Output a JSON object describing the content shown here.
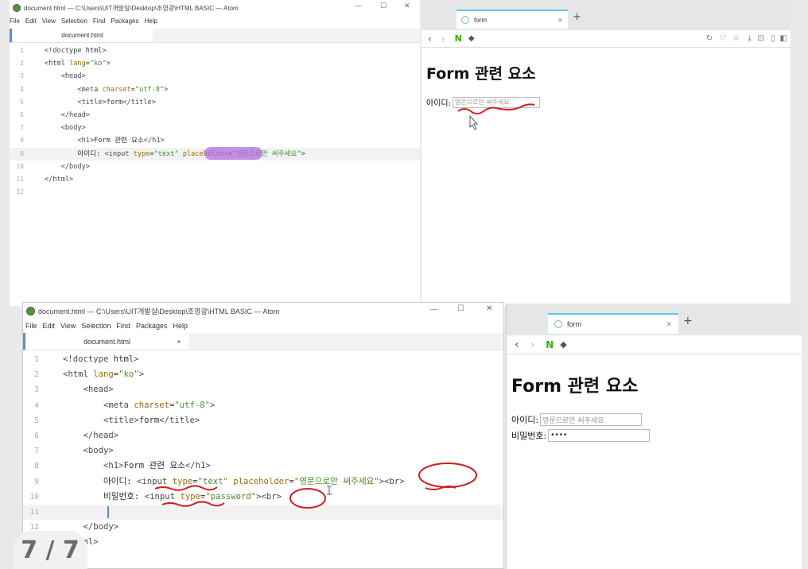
{
  "top": {
    "editor": {
      "window_title": "document.html — C:\\Users\\UIT개발실\\Desktop\\조영광\\HTML BASIC — Atom",
      "menu": [
        "File",
        "Edit",
        "View",
        "Selection",
        "Find",
        "Packages",
        "Help"
      ],
      "tab": "document.html",
      "lines": [
        {
          "n": "1",
          "t": "<!doctype html>"
        },
        {
          "n": "2",
          "t": "<html lang=\"ko\">"
        },
        {
          "n": "3",
          "t": "    <head>"
        },
        {
          "n": "4",
          "t": "        <meta charset=\"utf-8\">"
        },
        {
          "n": "5",
          "t": "        <title>form</title>"
        },
        {
          "n": "6",
          "t": "    </head>"
        },
        {
          "n": "7",
          "t": "    <body>"
        },
        {
          "n": "8",
          "t": "        <h1>Form 관련 요소</h1>"
        },
        {
          "n": "9",
          "t": "        아이디: <input type=\"text\" placeholder=\"영문으로만 써주세요\">"
        },
        {
          "n": "10",
          "t": "    </body>"
        },
        {
          "n": "11",
          "t": "</html>"
        },
        {
          "n": "12",
          "t": ""
        }
      ]
    },
    "browser": {
      "tab_title": "form",
      "h1": "Form 관련 요소",
      "id_label": "아이디:",
      "id_placeholder": "영문으로만 써주세요"
    }
  },
  "bottom": {
    "editor": {
      "window_title": "document.html — C:\\Users\\UIT개발실\\Desktop\\조영광\\HTML BASIC — Atom",
      "menu": [
        "File",
        "Edit",
        "View",
        "Selection",
        "Find",
        "Packages",
        "Help"
      ],
      "tab": "document.html",
      "lines": [
        {
          "n": "1",
          "t": "<!doctype html>"
        },
        {
          "n": "2",
          "t": "<html lang=\"ko\">"
        },
        {
          "n": "3",
          "t": "    <head>"
        },
        {
          "n": "4",
          "t": "        <meta charset=\"utf-8\">"
        },
        {
          "n": "5",
          "t": "        <title>form</title>"
        },
        {
          "n": "6",
          "t": "    </head>"
        },
        {
          "n": "7",
          "t": "    <body>"
        },
        {
          "n": "8",
          "t": "        <h1>Form 관련 요소</h1>"
        },
        {
          "n": "9",
          "t": "        아이디: <input type=\"text\" placeholder=\"영문으로만 써주세요\"><br>"
        },
        {
          "n": "10",
          "t": "        비밀번호: <input type=\"password\"><br>"
        },
        {
          "n": "11",
          "t": "        "
        },
        {
          "n": "12",
          "t": "    </body>"
        },
        {
          "n": "13",
          "t": "</html>"
        }
      ]
    },
    "browser": {
      "tab_title": "form",
      "h1": "Form 관련 요소",
      "id_label": "아이디:",
      "id_placeholder": "영문으로만 써주세요",
      "pw_label": "비밀번호:",
      "pw_value": "••••"
    }
  },
  "window_controls": {
    "minimize": "—",
    "maximize": "☐",
    "close": "✕"
  },
  "pager": "7 / 7"
}
